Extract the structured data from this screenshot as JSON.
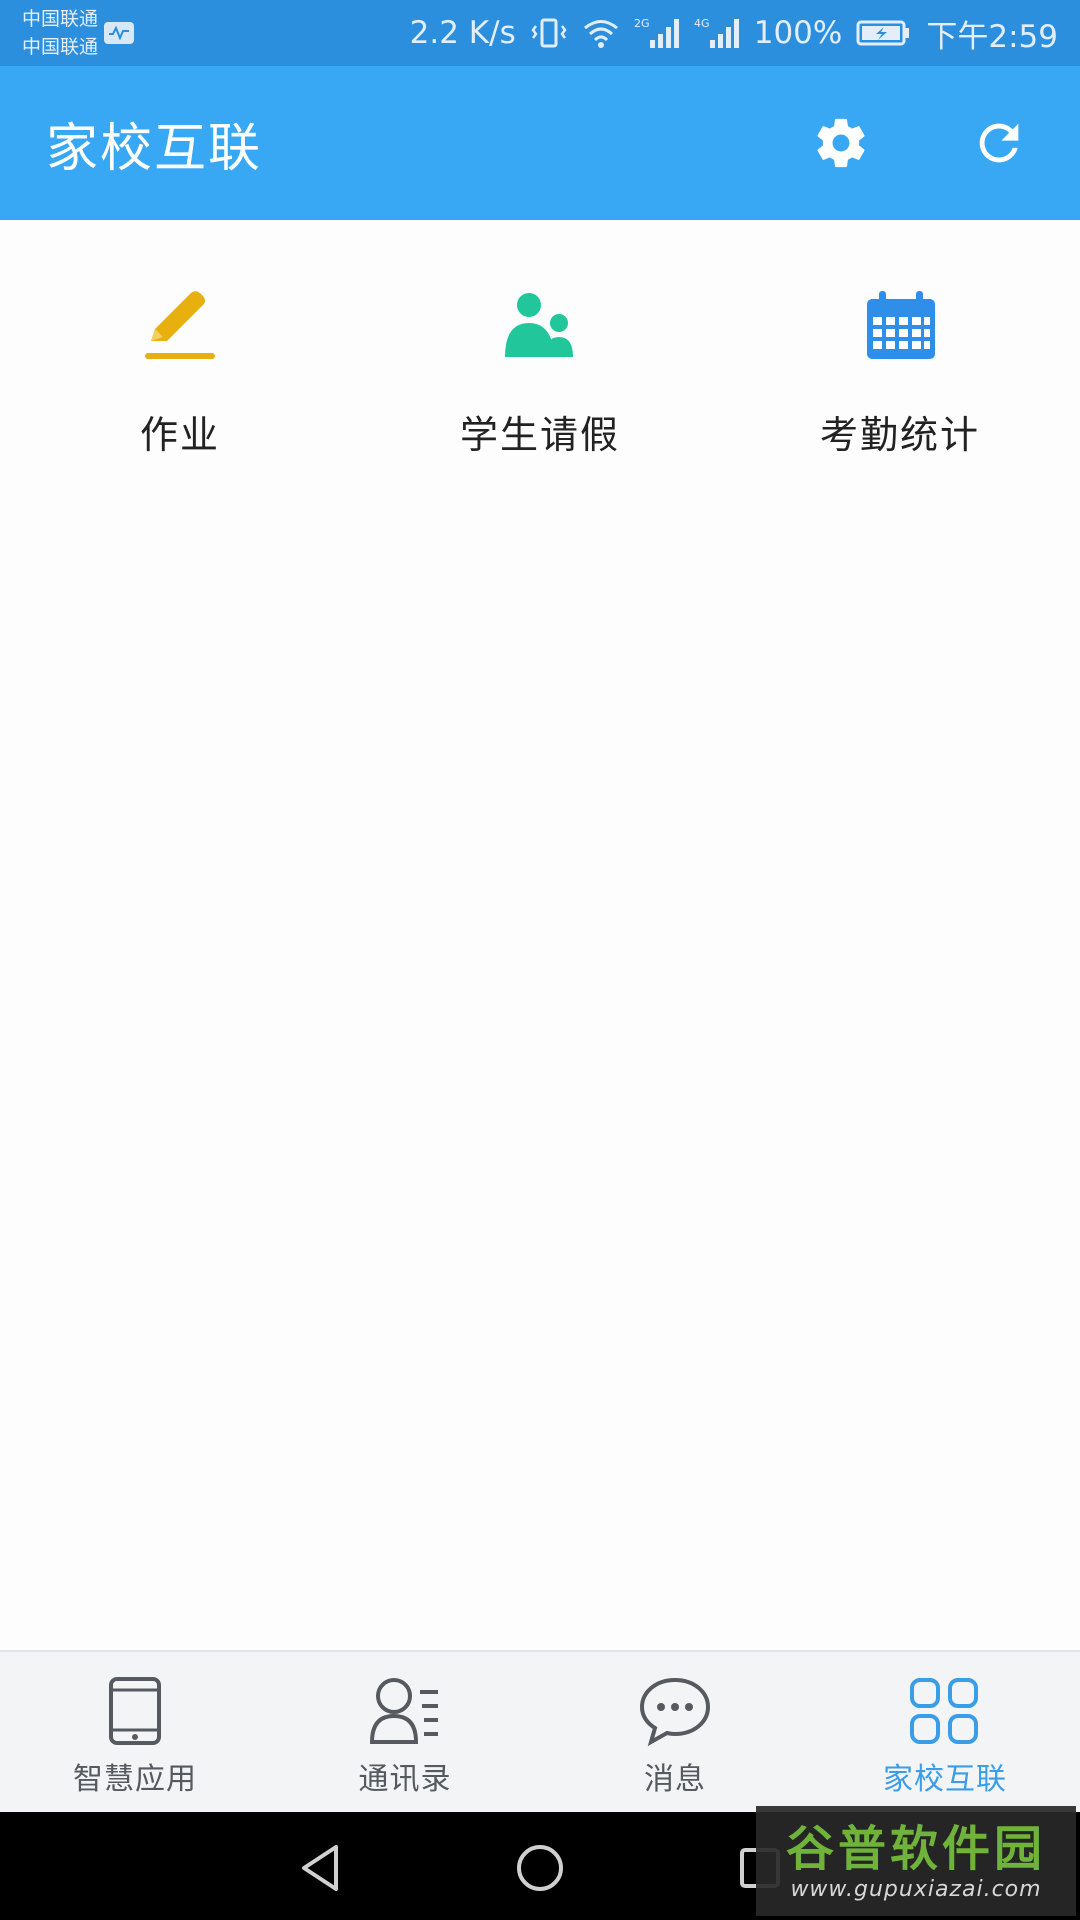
{
  "status_bar": {
    "carrier_1": "中国联通",
    "carrier_2": "中国联通",
    "network_speed": "2.2 K/s",
    "signal_1_label": "2G",
    "signal_2_label": "4G",
    "battery": "100%",
    "time": "下午2:59"
  },
  "app_bar": {
    "title": "家校互联",
    "settings_icon": "gear-icon",
    "refresh_icon": "refresh-icon"
  },
  "features": [
    {
      "label": "作业",
      "icon": "pencil-icon",
      "color": "#e8b00e"
    },
    {
      "label": "学生请假",
      "icon": "people-icon",
      "color": "#21c79a"
    },
    {
      "label": "考勤统计",
      "icon": "calendar-icon",
      "color": "#2f8ee8"
    }
  ],
  "bottom_nav": [
    {
      "label": "智慧应用",
      "icon": "tablet-icon",
      "active": false
    },
    {
      "label": "通讯录",
      "icon": "contacts-icon",
      "active": false
    },
    {
      "label": "消息",
      "icon": "chat-icon",
      "active": false
    },
    {
      "label": "家校互联",
      "icon": "grid-icon",
      "active": true
    }
  ],
  "colors": {
    "status_bar": "#2c8fde",
    "app_bar": "#38a8f4",
    "active_tab": "#3a9de8",
    "inactive_tab": "#555a60"
  },
  "watermark": {
    "title": "谷普软件园",
    "url": "www.gupuxiazai.com"
  }
}
